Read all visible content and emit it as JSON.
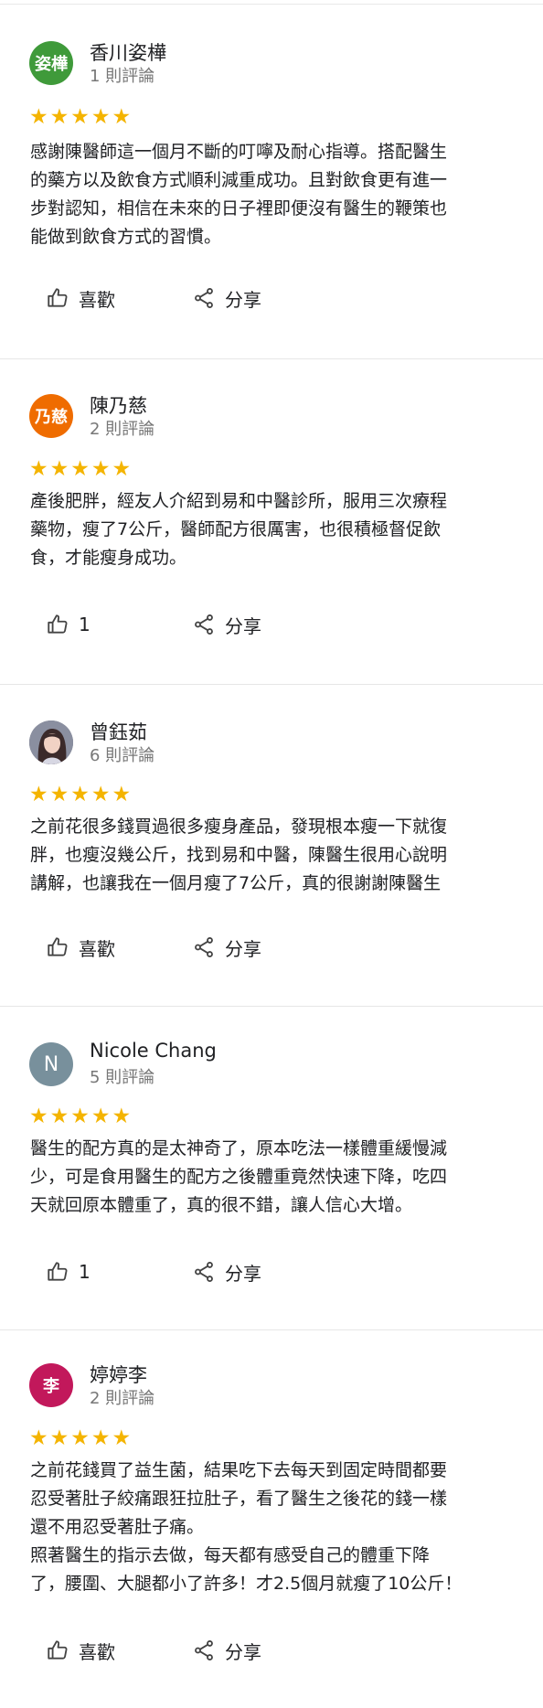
{
  "reviews": [
    {
      "avatar_text": "姿樺",
      "avatar_color": "#3f9a3a",
      "name": "香川姿樺",
      "count": "1 則評論",
      "stars": "★★★★★",
      "text": "感謝陳醫師這一個月不斷的叮嚀及耐心指導。搭配醫生\n的藥方以及飲食方式順利減重成功。且對飲食更有進一\n步對認知，相信在未來的日子裡即便沒有醫生的鞭策也\n能做到飲食方式的習慣。",
      "like_label": "喜歡",
      "share_label": "分享"
    },
    {
      "avatar_text": "乃慈",
      "avatar_color": "#ef6c00",
      "name": "陳乃慈",
      "count": "2 則評論",
      "stars": "★★★★★",
      "text": "產後肥胖，經友人介紹到易和中醫診所，服用三次療程\n藥物，瘦了7公斤，醫師配方很厲害，也很積極督促飲\n食，才能瘦身成功。",
      "like_label": "1",
      "share_label": "分享"
    },
    {
      "avatar_text": "",
      "avatar_color": "#6b6f7d",
      "name": "曾鈺茹",
      "count": "6 則評論",
      "stars": "★★★★★",
      "text": "之前花很多錢買過很多瘦身產品，發現根本瘦一下就復\n胖，也瘦沒幾公斤，找到易和中醫，陳醫生很用心說明\n講解，也讓我在一個月瘦了7公斤，真的很謝謝陳醫生",
      "like_label": "喜歡",
      "share_label": "分享"
    },
    {
      "avatar_text": "N",
      "avatar_color": "#78909c",
      "name": "Nicole Chang",
      "count": "5 則評論",
      "stars": "★★★★★",
      "text": "醫生的配方真的是太神奇了，原本吃法一樣體重緩慢減\n少，可是食用醫生的配方之後體重竟然快速下降，吃四\n天就回原本體重了，真的很不錯，讓人信心大增。",
      "like_label": "1",
      "share_label": "分享"
    },
    {
      "avatar_text": "李",
      "avatar_color": "#c2185b",
      "name": "婷婷李",
      "count": "2 則評論",
      "stars": "★★★★★",
      "text": "之前花錢買了益生菌，結果吃下去每天到固定時間都要\n忍受著肚子絞痛跟狂拉肚子，看了醫生之後花的錢一樣\n還不用忍受著肚子痛。\n照著醫生的指示去做，每天都有感受自己的體重下降\n了，腰圍、大腿都小了許多！才2.5個月就瘦了10公斤！",
      "like_label": "喜歡",
      "share_label": "分享"
    }
  ]
}
